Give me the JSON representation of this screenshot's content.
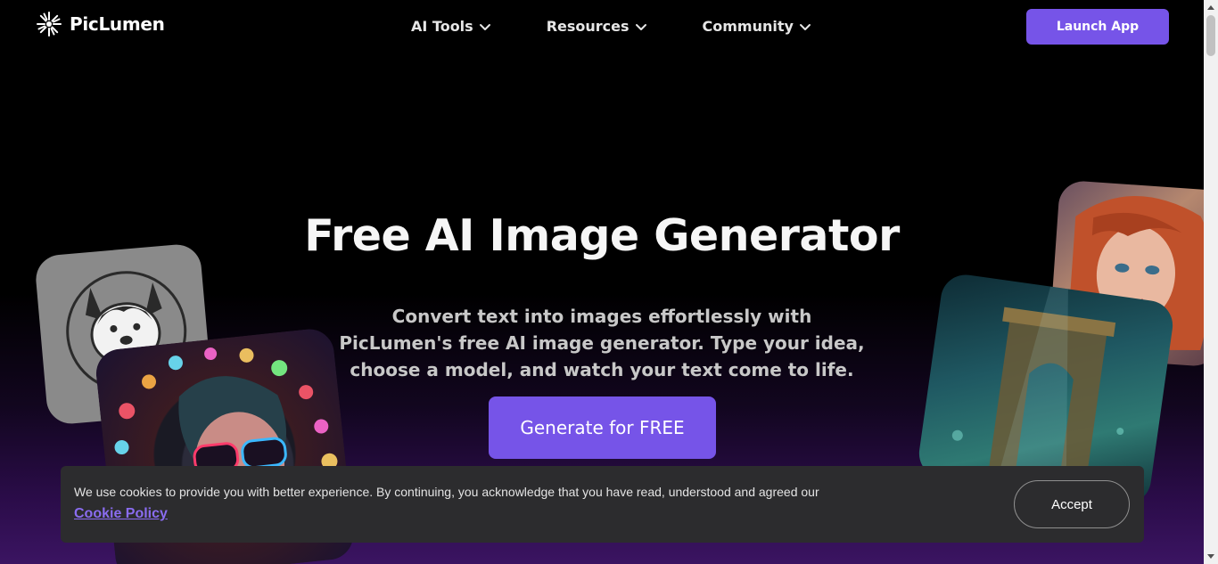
{
  "header": {
    "brand": "PicLumen",
    "nav": [
      {
        "label": "AI Tools"
      },
      {
        "label": "Resources"
      },
      {
        "label": "Community"
      }
    ],
    "launch_label": "Launch App"
  },
  "hero": {
    "title": "Free AI Image Generator",
    "subtitle": "Convert text into images effortlessly with PicLumen's free AI image generator. Type your idea, choose a model, and watch your text come to life.",
    "cta_label": "Generate for FREE"
  },
  "cookie": {
    "text": "We use cookies to provide you with better experience. By continuing, you acknowledge that you have read, understood and agreed our",
    "link_label": "Cookie Policy",
    "accept_label": "Accept"
  },
  "colors": {
    "accent": "#7654e8",
    "banner_bg": "#2c2c2e",
    "link": "#8a6cf0"
  },
  "icons": [
    "sunburst-logo-icon",
    "chevron-down-icon",
    "scroll-up-icon",
    "scroll-down-icon"
  ]
}
